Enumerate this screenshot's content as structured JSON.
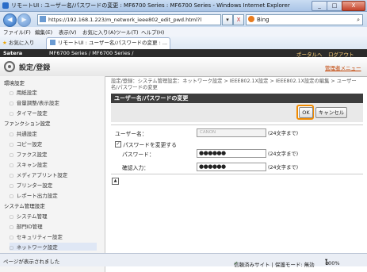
{
  "window": {
    "title": "リモートUI : ユーザー名/パスワードの変更 : MF6700 Series : MF6700 Series - Windows Internet Explorer",
    "minimize": "_",
    "maximize": "□",
    "close": "X"
  },
  "browser": {
    "url": "https://192.168.1.223/m_network_ieee802_edit_pwd.html?l",
    "search_placeholder": "Bing",
    "back": "◀",
    "forward": "▶",
    "refresh": "↻",
    "stop": "X",
    "menu": [
      "ファイル(F)",
      "編集(E)",
      "表示(V)",
      "お気に入り(A)",
      "ツール(T)",
      "ヘルプ(H)"
    ],
    "favorites_label": "お気に入り",
    "tab_label": "リモートUI : ユーザー名/パスワードの変更 : ..."
  },
  "app": {
    "brand": "Satera",
    "product": "MF6700 Series / MF6700 Series /",
    "portal_link": "ポータルへ",
    "logout_link": "ログアウト",
    "section_title": "設定/登録",
    "manager_menu": "管理者メニュー"
  },
  "sidebar": {
    "groups": [
      {
        "heading": "環境設定",
        "items": [
          "用紙設定",
          "音量調整/表示設定",
          "タイマー設定"
        ]
      },
      {
        "heading": "ファンクション設定",
        "items": [
          "共通設定",
          "コピー設定",
          "ファクス設定",
          "スキャン設定",
          "メディアプリント設定",
          "プリンター設定",
          "レポート出力設定"
        ]
      },
      {
        "heading": "システム管理設定",
        "items": [
          "システム管理",
          "部門ID管理",
          "セキュリティー設定",
          "ネットワーク設定"
        ]
      }
    ]
  },
  "main": {
    "breadcrumb": "設定/登録：システム管理設定：ネットワーク設定 > IEEE802.1X設定 > IEEE802.1X設定の編集 > ユーザー名/パスワードの変更",
    "panel_title": "ユーザー名/パスワードの変更",
    "ok_button": "OK",
    "cancel_button": "キャンセル",
    "username_label": "ユーザー名：",
    "username_value": "CANON",
    "username_hint": "(24文字まで)",
    "change_password_label": "パスワードを変更する",
    "change_password_checked": true,
    "password_label": "パスワード：",
    "password_value": "●●●●●●",
    "password_hint": "(24文字まで)",
    "confirm_label": "確認入力：",
    "confirm_value": "●●●●●●",
    "confirm_hint": "(24文字まで)"
  },
  "status": {
    "left": "ページが表示されました",
    "zone": "信頼済みサイト | 保護モード: 無効",
    "zoom": "100%"
  }
}
